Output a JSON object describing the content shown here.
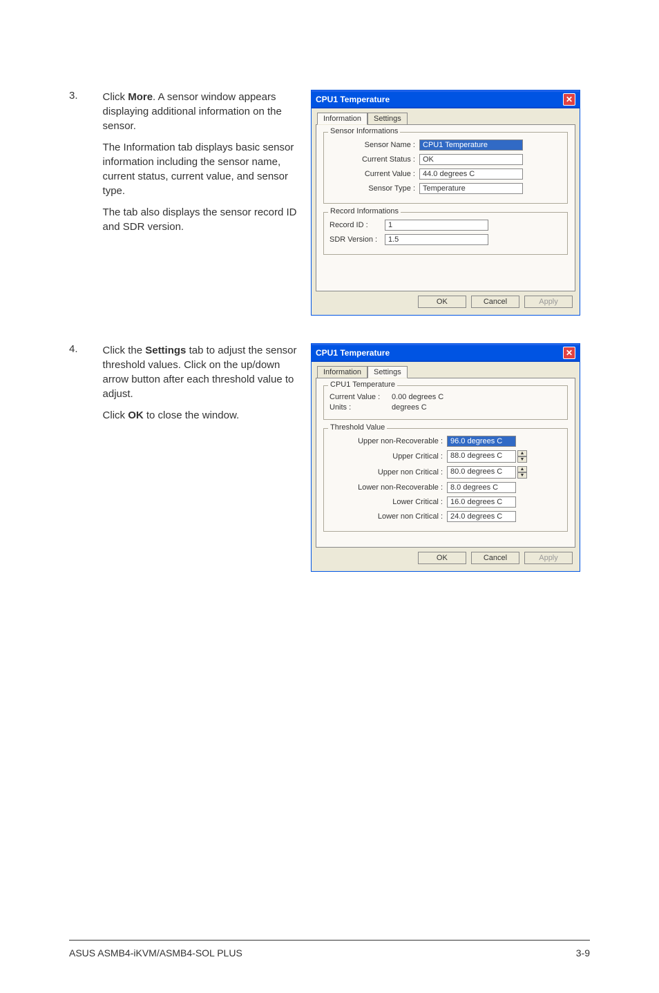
{
  "steps": [
    {
      "num": "3.",
      "paragraphs": [
        "Click <b>More</b>. A sensor window appears displaying additional information on the sensor.",
        "The Information tab displays basic sensor information including the sensor name, current status, current value, and sensor type.",
        "The tab also displays the sensor record ID and SDR version."
      ]
    },
    {
      "num": "4.",
      "paragraphs": [
        "Click the <b>Settings</b> tab to adjust the sensor threshold values. Click on the up/down arrow button after each threshold value to adjust.",
        "Click <b>OK</b> to close the window."
      ]
    }
  ],
  "dialog1": {
    "title": "CPU1 Temperature",
    "tabs": {
      "info": "Information",
      "settings": "Settings"
    },
    "group1": {
      "title": "Sensor Informations",
      "sensor_name_label": "Sensor Name  :",
      "sensor_name_value": "CPU1 Temperature",
      "current_status_label": "Current Status :",
      "current_status_value": "OK",
      "current_value_label": "Current Value  :",
      "current_value_value": "44.0 degrees C",
      "sensor_type_label": "Sensor Type   :",
      "sensor_type_value": "Temperature"
    },
    "group2": {
      "title": "Record Informations",
      "record_id_label": "Record ID      :",
      "record_id_value": "1",
      "sdr_version_label": "SDR Version :",
      "sdr_version_value": "1.5"
    },
    "buttons": {
      "ok": "OK",
      "cancel": "Cancel",
      "apply": "Apply"
    }
  },
  "dialog2": {
    "title": "CPU1 Temperature",
    "tabs": {
      "info": "Information",
      "settings": "Settings"
    },
    "group1": {
      "title": "CPU1 Temperature",
      "current_value_label": "Current Value :",
      "current_value_value": "0.00 degrees C",
      "units_label": "Units              :",
      "units_value": "degrees C"
    },
    "group2": {
      "title": "Threshold Value",
      "upper_nr_label": "Upper non-Recoverable :",
      "upper_nr_value": "96.0 degrees C",
      "upper_crit_label": "Upper Critical :",
      "upper_crit_value": "88.0 degrees C",
      "upper_noncrit_label": "Upper non Critical :",
      "upper_noncrit_value": "80.0 degrees C",
      "lower_nr_label": "Lower non-Recoverable :",
      "lower_nr_value": "8.0 degrees C",
      "lower_crit_label": "Lower Critical :",
      "lower_crit_value": "16.0 degrees C",
      "lower_noncrit_label": "Lower non Critical :",
      "lower_noncrit_value": "24.0 degrees C"
    },
    "buttons": {
      "ok": "OK",
      "cancel": "Cancel",
      "apply": "Apply"
    }
  },
  "footer": {
    "left": "ASUS ASMB4-iKVM/ASMB4-SOL PLUS",
    "right": "3-9"
  }
}
